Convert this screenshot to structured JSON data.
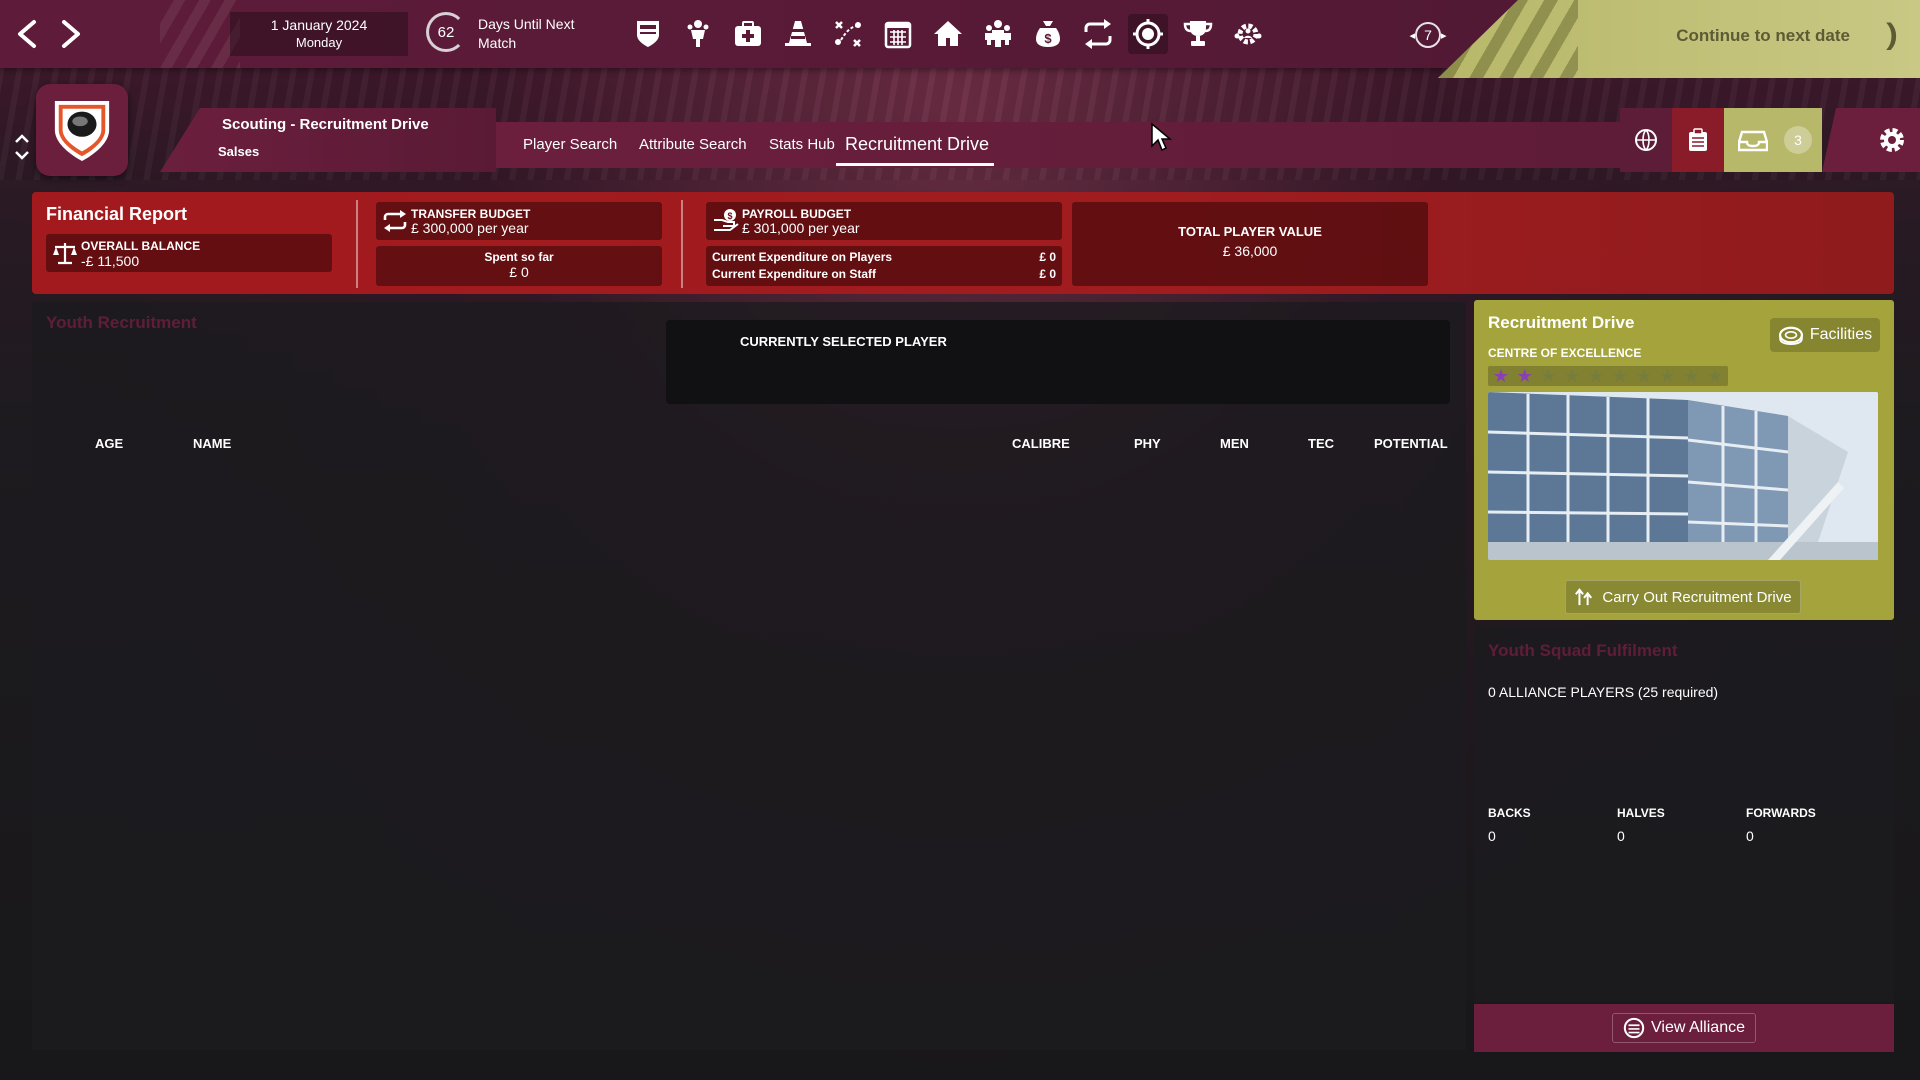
{
  "topbar": {
    "date": "1 January 2024",
    "weekday": "Monday",
    "days_until_match": "62",
    "days_label_line1": "Days Until Next",
    "days_label_line2": "Match",
    "notification_count": "7",
    "continue_label": "Continue to next date",
    "continue_glyph": "))",
    "nav_icons": [
      "club-badge-icon",
      "players-icon",
      "medical-icon",
      "training-cone-icon",
      "tactics-icon",
      "calendar-icon",
      "stadium-home-icon",
      "staff-icon",
      "finance-moneybag-icon",
      "transfers-icon",
      "scouting-target-icon",
      "trophy-icon",
      "settings-team-icon"
    ]
  },
  "header": {
    "title": "Scouting - Recruitment Drive",
    "subtitle": "Salses",
    "inbox_badge": "3"
  },
  "tabs": [
    {
      "label": "Player Search"
    },
    {
      "label": "Attribute Search"
    },
    {
      "label": "Stats Hub"
    },
    {
      "label": "Recruitment Drive",
      "active": true
    }
  ],
  "finance": {
    "title": "Financial Report",
    "overall_balance_label": "OVERALL BALANCE",
    "overall_balance_value": "-£ 11,500",
    "transfer_budget_label": "TRANSFER BUDGET",
    "transfer_budget_value": "£ 300,000 per year",
    "spent_label": "Spent so far",
    "spent_value": "£ 0",
    "payroll_label": "PAYROLL BUDGET",
    "payroll_value": "£ 301,000 per year",
    "exp_players_label": "Current Expenditure on Players",
    "exp_players_value": "£ 0",
    "exp_staff_label": "Current Expenditure on Staff",
    "exp_staff_value": "£ 0",
    "total_value_label": "TOTAL PLAYER VALUE",
    "total_value": "£ 36,000"
  },
  "youth": {
    "title": "Youth Recruitment",
    "selected_player_label": "CURRENTLY SELECTED PLAYER",
    "columns": [
      "AGE",
      "NAME",
      "CALIBRE",
      "PHY",
      "MEN",
      "TEC",
      "POTENTIAL"
    ]
  },
  "recruitment": {
    "title": "Recruitment Drive",
    "facilities_label": "Facilities",
    "centre_label": "CENTRE OF EXCELLENCE",
    "stars_total": 10,
    "stars_filled": 2,
    "carry_out_label": "Carry Out Recruitment Drive"
  },
  "squad": {
    "title": "Youth Squad Fulfilment",
    "alliance_players": "0 ALLIANCE PLAYERS (25 required)",
    "positions": [
      {
        "label": "BACKS",
        "value": "0"
      },
      {
        "label": "HALVES",
        "value": "0"
      },
      {
        "label": "FORWARDS",
        "value": "0"
      }
    ],
    "view_alliance_label": "View Alliance"
  },
  "colors": {
    "brand_maroon": "#6b1f3d",
    "finance_red": "#a31a1e",
    "accent_olive": "#a5a43c",
    "muted_title": "#5e1e37",
    "star_active": "#8a3fb8"
  }
}
